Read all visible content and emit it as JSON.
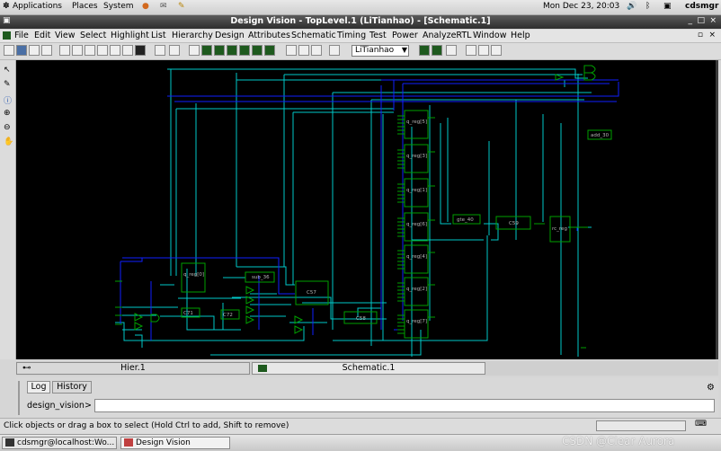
{
  "top_panel": {
    "applications": "Applications",
    "places": "Places",
    "system": "System",
    "datetime": "Mon Dec 23, 20:03",
    "user": "cdsmgr"
  },
  "window": {
    "title": "Design Vision - TopLevel.1 (LiTianhao) - [Schematic.1]"
  },
  "menu": [
    "File",
    "Edit",
    "View",
    "Select",
    "Highlight",
    "List",
    "Hierarchy",
    "Design",
    "Attributes",
    "Schematic",
    "Timing",
    "Test",
    "Power",
    "AnalyzeRTL",
    "Window",
    "Help"
  ],
  "toolbar": {
    "design_select": "LiTianhao"
  },
  "schematic": {
    "labels": {
      "add": "add_30",
      "q5": "q_reg[5]",
      "q3": "q_reg[3]",
      "q1": "q_reg[1]",
      "q6": "q_reg[6]",
      "q4": "q_reg[4]",
      "q2": "q_reg[2]",
      "q7": "q_reg[7]",
      "q0": "q_reg[0]",
      "gte": "gte_40",
      "c59": "C59",
      "rc": "rc_reg",
      "sub": "sub_36",
      "c57": "C57",
      "c58": "C58",
      "c71": "C71",
      "c72": "C72"
    }
  },
  "tabs": {
    "hier": "Hier.1",
    "schematic": "Schematic.1"
  },
  "console": {
    "log_tab": "Log",
    "history_tab": "History",
    "prompt": "design_vision>"
  },
  "status": {
    "message": "Click objects or drag a box to select (Hold Ctrl to add, Shift to remove)"
  },
  "taskbar": {
    "terminal": "cdsmgr@localhost:Wo...",
    "design_vision": "Design Vision"
  },
  "watermark": "CSDN @Clear Aurora",
  "colors": {
    "wire_cyan": "#00c8c8",
    "wire_blue": "#1020ff",
    "cell_green": "#00a000",
    "canvas_bg": "#000000"
  }
}
